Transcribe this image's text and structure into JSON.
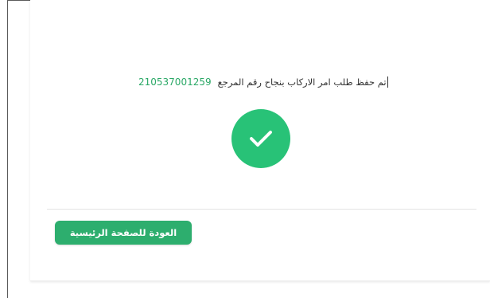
{
  "confirmation": {
    "message": "تم حفظ طلب امر الاركاب بنجاح رقم المرجع",
    "reference_number": "210537001259"
  },
  "status": {
    "icon": "check-circle-icon",
    "color": "#28c277"
  },
  "actions": {
    "home_button_label": "العودة للصفحة الرئيسية"
  }
}
